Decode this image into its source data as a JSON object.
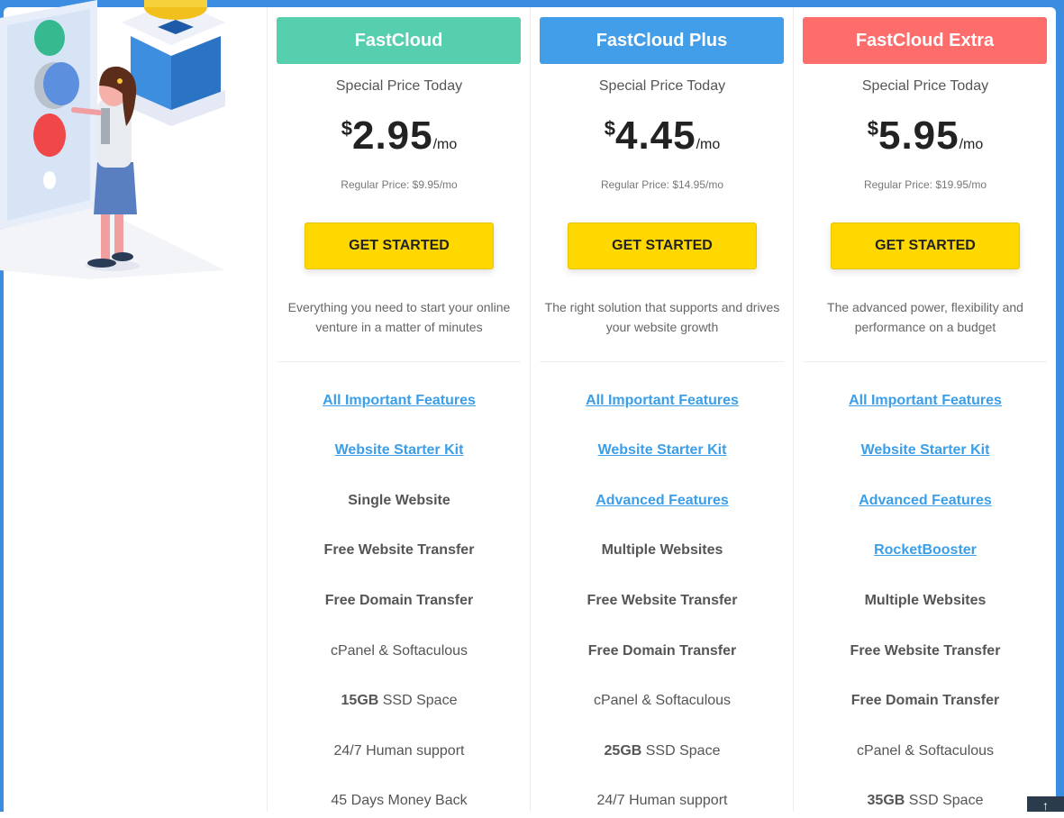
{
  "colors": {
    "header1": "#55cfae",
    "header2": "#429ee9",
    "header3": "#fd6d6c",
    "cta": "#ffd800",
    "link": "#3b9ee9",
    "background_accent": "#3a8de0"
  },
  "plans": [
    {
      "name": "FastCloud",
      "special": "Special Price Today",
      "currency": "$",
      "amount": "2.95",
      "period": "/mo",
      "regular": "Regular Price: $9.95/mo",
      "cta": "GET STARTED",
      "description": "Everything you need to start your online venture in a matter of minutes",
      "features": [
        {
          "text": "All Important Features",
          "style": "link"
        },
        {
          "text": "Website Starter Kit",
          "style": "link"
        },
        {
          "text": "Single Website",
          "style": "bold"
        },
        {
          "text": "Free Website Transfer",
          "style": "bold"
        },
        {
          "text": "Free Domain Transfer",
          "style": "bold"
        },
        {
          "text": "cPanel & Softaculous",
          "style": "plain"
        },
        {
          "bold_part": "15GB",
          "text": " SSD Space",
          "style": "mixed"
        },
        {
          "text": "24/7 Human support",
          "style": "plain"
        },
        {
          "text": "45 Days Money Back",
          "style": "plain"
        }
      ]
    },
    {
      "name": "FastCloud Plus",
      "special": "Special Price Today",
      "currency": "$",
      "amount": "4.45",
      "period": "/mo",
      "regular": "Regular Price: $14.95/mo",
      "cta": "GET STARTED",
      "description": "The right solution that supports and drives your website growth",
      "features": [
        {
          "text": "All Important Features",
          "style": "link"
        },
        {
          "text": "Website Starter Kit",
          "style": "link"
        },
        {
          "text": "Advanced Features",
          "style": "link"
        },
        {
          "text": "Multiple Websites",
          "style": "bold"
        },
        {
          "text": "Free Website Transfer",
          "style": "bold"
        },
        {
          "text": "Free Domain Transfer",
          "style": "bold"
        },
        {
          "text": "cPanel & Softaculous",
          "style": "plain"
        },
        {
          "bold_part": "25GB",
          "text": " SSD Space",
          "style": "mixed"
        },
        {
          "text": "24/7 Human support",
          "style": "plain"
        }
      ]
    },
    {
      "name": "FastCloud Extra",
      "special": "Special Price Today",
      "currency": "$",
      "amount": "5.95",
      "period": "/mo",
      "regular": "Regular Price: $19.95/mo",
      "cta": "GET STARTED",
      "description": "The advanced power, flexibility and performance on a budget",
      "features": [
        {
          "text": "All Important Features",
          "style": "link"
        },
        {
          "text": "Website Starter Kit",
          "style": "link"
        },
        {
          "text": "Advanced Features",
          "style": "link"
        },
        {
          "text": "RocketBooster",
          "style": "link"
        },
        {
          "text": "Multiple Websites",
          "style": "bold"
        },
        {
          "text": "Free Website Transfer",
          "style": "bold"
        },
        {
          "text": "Free Domain Transfer",
          "style": "bold"
        },
        {
          "text": "cPanel & Softaculous",
          "style": "plain"
        },
        {
          "bold_part": "35GB",
          "text": " SSD Space",
          "style": "mixed"
        }
      ]
    }
  ],
  "scroll_top_icon": "arrow-up-icon",
  "scroll_top_glyph": "↑"
}
